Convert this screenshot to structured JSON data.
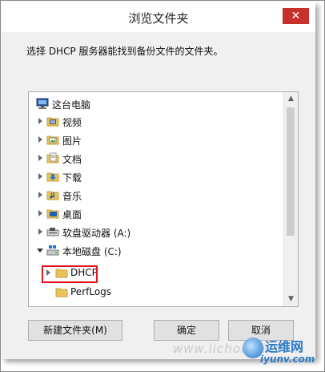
{
  "window": {
    "title": "浏览文件夹",
    "close_glyph": "✕"
  },
  "instruction": "选择 DHCP 服务器能找到备份文件的文件夹。",
  "tree": {
    "items": [
      {
        "label": "这台电脑",
        "icon": "computer-icon",
        "expander": "none"
      },
      {
        "label": "视频",
        "icon": "video-folder-icon",
        "expander": "collapsed"
      },
      {
        "label": "图片",
        "icon": "pictures-folder-icon",
        "expander": "collapsed"
      },
      {
        "label": "文档",
        "icon": "documents-folder-icon",
        "expander": "collapsed"
      },
      {
        "label": "下载",
        "icon": "downloads-folder-icon",
        "expander": "collapsed"
      },
      {
        "label": "音乐",
        "icon": "music-folder-icon",
        "expander": "collapsed"
      },
      {
        "label": "桌面",
        "icon": "desktop-folder-icon",
        "expander": "collapsed"
      },
      {
        "label": "软盘驱动器 (A:)",
        "icon": "floppy-drive-icon",
        "expander": "collapsed"
      },
      {
        "label": "本地磁盘 (C:)",
        "icon": "local-disk-icon",
        "expander": "expanded"
      },
      {
        "label": "DHCP",
        "icon": "folder-icon",
        "expander": "collapsed",
        "highlighted": true
      },
      {
        "label": "PerfLogs",
        "icon": "folder-icon",
        "expander": "none"
      }
    ]
  },
  "buttons": {
    "new_folder": "新建文件夹(M)",
    "ok": "确定",
    "cancel": "取消"
  },
  "watermark": {
    "url_text": "www.lichongni.com",
    "logo_cn": "运维网",
    "logo_en": "iyunv.com"
  },
  "colors": {
    "close": "#c7312b",
    "highlight_border": "#e0141e",
    "folder": "#e8c25a"
  }
}
